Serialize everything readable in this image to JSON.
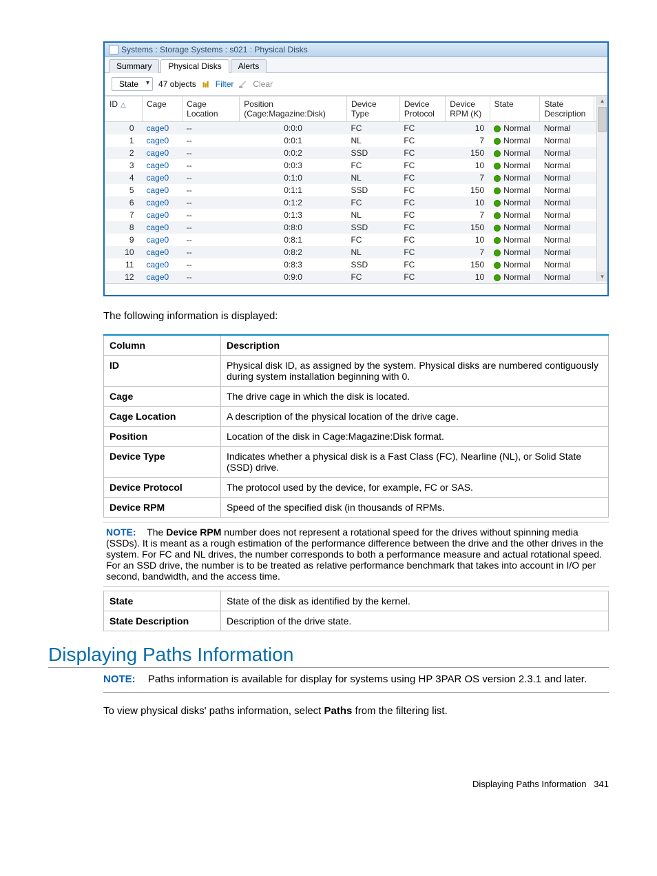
{
  "window": {
    "title": "Systems : Storage Systems : s021 : Physical Disks",
    "tabs": [
      "Summary",
      "Physical Disks",
      "Alerts"
    ],
    "active_tab": 1,
    "filter": {
      "dropdown": "State",
      "count": "47 objects",
      "filter_label": "Filter",
      "clear_label": "Clear"
    },
    "columns": {
      "id": "ID",
      "cage": "Cage",
      "cage_location": "Cage Location",
      "position": "Position",
      "position_sub": "(Cage:Magazine:Disk)",
      "device_type": "Device Type",
      "device_protocol": "Device Protocol",
      "device_rpm": "Device RPM (K)",
      "state": "State",
      "state_desc": "State Description"
    },
    "rows": [
      {
        "id": "0",
        "cage": "cage0",
        "loc": "--",
        "pos": "0:0:0",
        "type": "FC",
        "proto": "FC",
        "rpm": "10",
        "state": "Normal",
        "desc": "Normal"
      },
      {
        "id": "1",
        "cage": "cage0",
        "loc": "--",
        "pos": "0:0:1",
        "type": "NL",
        "proto": "FC",
        "rpm": "7",
        "state": "Normal",
        "desc": "Normal"
      },
      {
        "id": "2",
        "cage": "cage0",
        "loc": "--",
        "pos": "0:0:2",
        "type": "SSD",
        "proto": "FC",
        "rpm": "150",
        "state": "Normal",
        "desc": "Normal"
      },
      {
        "id": "3",
        "cage": "cage0",
        "loc": "--",
        "pos": "0:0:3",
        "type": "FC",
        "proto": "FC",
        "rpm": "10",
        "state": "Normal",
        "desc": "Normal"
      },
      {
        "id": "4",
        "cage": "cage0",
        "loc": "--",
        "pos": "0:1:0",
        "type": "NL",
        "proto": "FC",
        "rpm": "7",
        "state": "Normal",
        "desc": "Normal"
      },
      {
        "id": "5",
        "cage": "cage0",
        "loc": "--",
        "pos": "0:1:1",
        "type": "SSD",
        "proto": "FC",
        "rpm": "150",
        "state": "Normal",
        "desc": "Normal"
      },
      {
        "id": "6",
        "cage": "cage0",
        "loc": "--",
        "pos": "0:1:2",
        "type": "FC",
        "proto": "FC",
        "rpm": "10",
        "state": "Normal",
        "desc": "Normal"
      },
      {
        "id": "7",
        "cage": "cage0",
        "loc": "--",
        "pos": "0:1:3",
        "type": "NL",
        "proto": "FC",
        "rpm": "7",
        "state": "Normal",
        "desc": "Normal"
      },
      {
        "id": "8",
        "cage": "cage0",
        "loc": "--",
        "pos": "0:8:0",
        "type": "SSD",
        "proto": "FC",
        "rpm": "150",
        "state": "Normal",
        "desc": "Normal"
      },
      {
        "id": "9",
        "cage": "cage0",
        "loc": "--",
        "pos": "0:8:1",
        "type": "FC",
        "proto": "FC",
        "rpm": "10",
        "state": "Normal",
        "desc": "Normal"
      },
      {
        "id": "10",
        "cage": "cage0",
        "loc": "--",
        "pos": "0:8:2",
        "type": "NL",
        "proto": "FC",
        "rpm": "7",
        "state": "Normal",
        "desc": "Normal"
      },
      {
        "id": "11",
        "cage": "cage0",
        "loc": "--",
        "pos": "0:8:3",
        "type": "SSD",
        "proto": "FC",
        "rpm": "150",
        "state": "Normal",
        "desc": "Normal"
      },
      {
        "id": "12",
        "cage": "cage0",
        "loc": "--",
        "pos": "0:9:0",
        "type": "FC",
        "proto": "FC",
        "rpm": "10",
        "state": "Normal",
        "desc": "Normal"
      }
    ]
  },
  "doc": {
    "intro": "The following information is displayed:",
    "table_header": {
      "col": "Column",
      "desc": "Description"
    },
    "rows1": [
      {
        "c": "ID",
        "d": "Physical disk ID, as assigned by the system. Physical disks are numbered contiguously during system installation beginning with 0."
      },
      {
        "c": "Cage",
        "d": "The drive cage in which the disk is located."
      },
      {
        "c": "Cage Location",
        "d": "A description of the physical location of the drive cage."
      },
      {
        "c": "Position",
        "d": "Location of the disk in Cage:Magazine:Disk format."
      },
      {
        "c": "Device Type",
        "d": "Indicates whether a physical disk is a Fast Class (FC), Nearline (NL), or Solid State (SSD) drive."
      },
      {
        "c": "Device Protocol",
        "d": "The protocol used by the device, for example, FC or SAS."
      },
      {
        "c": "Device RPM",
        "d": "Speed of the specified disk (in thousands of RPMs."
      }
    ],
    "note1_label": "NOTE:",
    "note1_pre": "The ",
    "note1_bold": "Device RPM",
    "note1_text": " number does not represent a rotational speed for the drives without spinning media (SSDs). It is meant as a rough estimation of the performance difference between the drive and the other drives in the system. For FC and NL drives, the number corresponds to both a performance measure and actual rotational speed. For an SSD drive, the number is to be treated as relative performance benchmark that takes into account in I/O per second, bandwidth, and the access time.",
    "rows2": [
      {
        "c": "State",
        "d": "State of the disk as identified by the kernel."
      },
      {
        "c": "State Description",
        "d": "Description of the drive state."
      }
    ],
    "heading": "Displaying Paths Information",
    "note2_label": "NOTE:",
    "note2_text": "Paths information is available for display for systems using HP 3PAR OS version 2.3.1 and later.",
    "para_pre": "To view physical disks' paths information, select ",
    "para_bold": "Paths",
    "para_post": " from the filtering list.",
    "footer_title": "Displaying Paths Information",
    "footer_page": "341"
  }
}
